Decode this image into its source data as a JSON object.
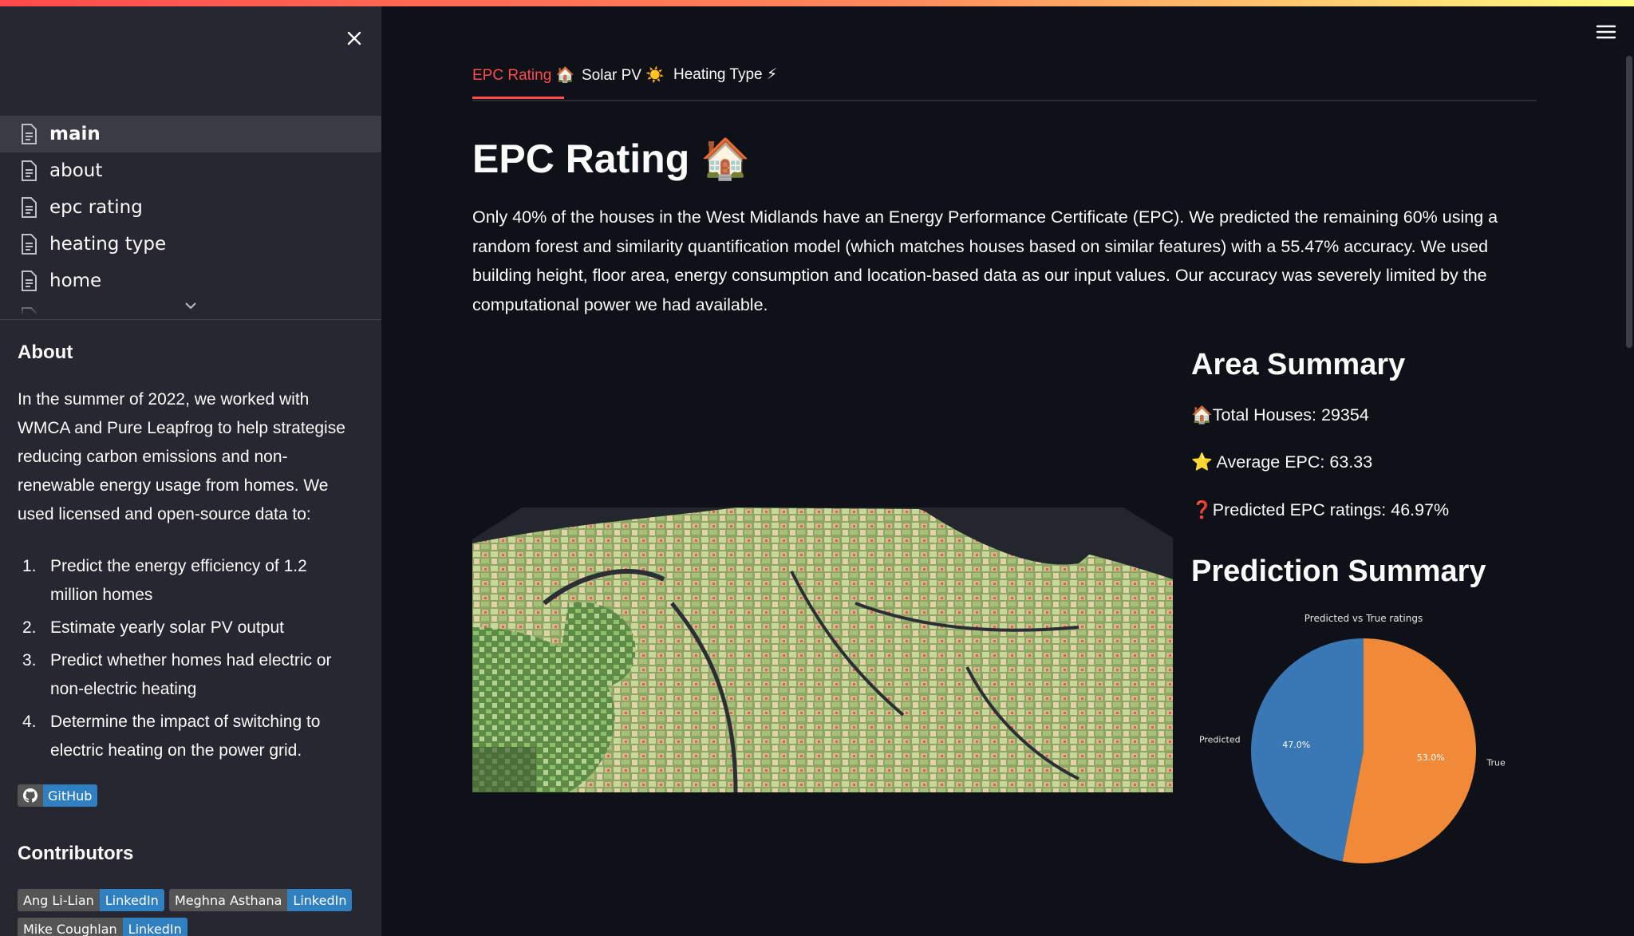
{
  "sidebar": {
    "nav_items": [
      {
        "label": "main",
        "active": true
      },
      {
        "label": "about",
        "active": false
      },
      {
        "label": "epc rating",
        "active": false
      },
      {
        "label": "heating type",
        "active": false
      },
      {
        "label": "home",
        "active": false
      }
    ],
    "about_heading": "About",
    "about_text": "In the summer of 2022, we worked with WMCA and Pure Leapfrog to help strategise reducing carbon emissions and non-renewable energy usage from homes. We used licensed and open-source data to:",
    "goals": [
      {
        "num": "1.",
        "text": "Predict the energy efficiency of 1.2 million homes"
      },
      {
        "num": "2.",
        "text": "Estimate yearly solar PV output"
      },
      {
        "num": "3.",
        "text": "Predict whether homes had electric or non-electric heating"
      },
      {
        "num": "4.",
        "text": "Determine the impact of switching to electric heating on the power grid."
      }
    ],
    "github_label": "GitHub",
    "contributors_heading": "Contributors",
    "contributors": [
      {
        "name": "Ang Li-Lian",
        "link": "LinkedIn"
      },
      {
        "name": "Meghna Asthana",
        "link": "LinkedIn"
      },
      {
        "name": "Mike Coughlan",
        "link": "LinkedIn"
      }
    ]
  },
  "tabs": [
    {
      "label": "EPC Rating 🏠",
      "active": true
    },
    {
      "label": "Solar PV ☀️",
      "active": false
    },
    {
      "label": "Heating Type ⚡",
      "active": false
    }
  ],
  "main": {
    "title": "EPC Rating 🏠",
    "intro": "Only 40% of the houses in the West Midlands have an Energy Performance Certificate (EPC). We predicted the remaining 60% using a random forest and similarity quantification model (which matches houses based on similar features) with a 55.47% accuracy. We used building height, floor area, energy consumption and location-based data as our input values. Our accuracy was severely limited by the computational power we had available.",
    "area_summary_title": "Area Summary",
    "stats": [
      "🏠Total Houses: 29354",
      "⭐ Average EPC: 63.33",
      "❓Predicted EPC ratings: 46.97%"
    ],
    "prediction_summary_title": "Prediction Summary"
  },
  "chart_data": {
    "type": "pie",
    "title": "Predicted vs True ratings",
    "labels": [
      "Predicted",
      "True"
    ],
    "values": [
      47.0,
      53.0
    ],
    "value_labels": [
      "47.0%",
      "53.0%"
    ],
    "colors": [
      "#3a78b5",
      "#f08a38"
    ]
  },
  "colors": {
    "accent": "#ff4b4b",
    "sidebar_bg": "#262730",
    "main_bg": "#0e1117",
    "badge_blue": "#2f7fc1"
  }
}
